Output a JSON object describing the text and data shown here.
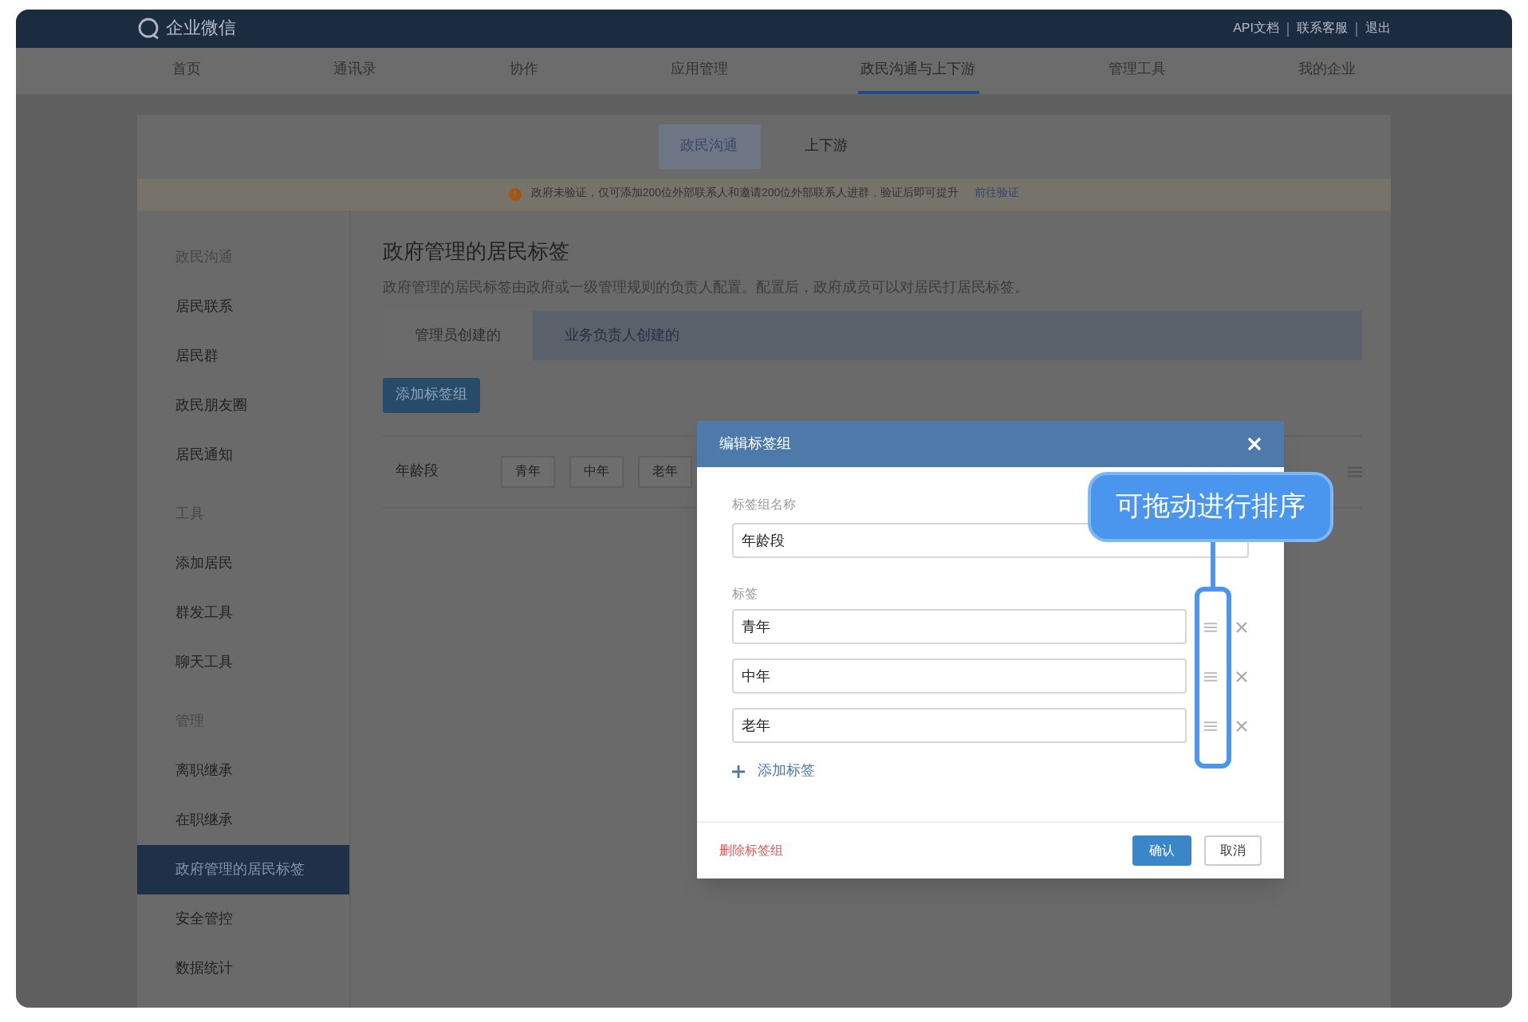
{
  "top_bar": {
    "logo_text": "企业微信",
    "links": [
      "API文档",
      "联系客服",
      "退出"
    ]
  },
  "nav": [
    {
      "label": "首页",
      "selected": false
    },
    {
      "label": "通讯录",
      "selected": false
    },
    {
      "label": "协作",
      "selected": false
    },
    {
      "label": "应用管理",
      "selected": false
    },
    {
      "label": "政民沟通与上下游",
      "selected": true
    },
    {
      "label": "管理工具",
      "selected": false
    },
    {
      "label": "我的企业",
      "selected": false
    }
  ],
  "subtabs": [
    {
      "label": "政民沟通",
      "selected": true
    },
    {
      "label": "上下游",
      "selected": false
    }
  ],
  "notice": {
    "text": "政府未验证，仅可添加200位外部联系人和邀请200位外部联系人进群，验证后即可提升",
    "link": "前往验证"
  },
  "sidebar": [
    {
      "title": "政民沟通",
      "items": [
        {
          "label": "居民联系",
          "selected": false
        },
        {
          "label": "居民群",
          "selected": false
        },
        {
          "label": "政民朋友圈",
          "selected": false
        },
        {
          "label": "居民通知",
          "selected": false
        }
      ]
    },
    {
      "title": "工具",
      "items": [
        {
          "label": "添加居民",
          "selected": false
        },
        {
          "label": "群发工具",
          "selected": false
        },
        {
          "label": "聊天工具",
          "selected": false
        }
      ]
    },
    {
      "title": "管理",
      "items": [
        {
          "label": "离职继承",
          "selected": false
        },
        {
          "label": "在职继承",
          "selected": false
        },
        {
          "label": "政府管理的居民标签",
          "selected": true
        },
        {
          "label": "安全管控",
          "selected": false
        },
        {
          "label": "数据统计",
          "selected": false
        }
      ]
    }
  ],
  "main": {
    "title": "政府管理的居民标签",
    "description": "政府管理的居民标签由政府或一级管理规则的负责人配置。配置后，政府成员可以对居民打居民标签。",
    "tabs": [
      {
        "label": "管理员创建的",
        "selected": true
      },
      {
        "label": "业务负责人创建的",
        "selected": false
      }
    ],
    "add_button": "添加标签组",
    "rows": [
      {
        "name": "年龄段",
        "tags": [
          "青年",
          "中年",
          "老年"
        ]
      }
    ]
  },
  "modal": {
    "title": "编辑标签组",
    "name_label": "标签组名称",
    "name_value": "年龄段",
    "tags_label": "标签",
    "tags": [
      "青年",
      "中年",
      "老年"
    ],
    "add_tag": "添加标签",
    "delete": "删除标签组",
    "confirm": "确认",
    "cancel": "取消"
  },
  "callout": "可拖动进行排序"
}
